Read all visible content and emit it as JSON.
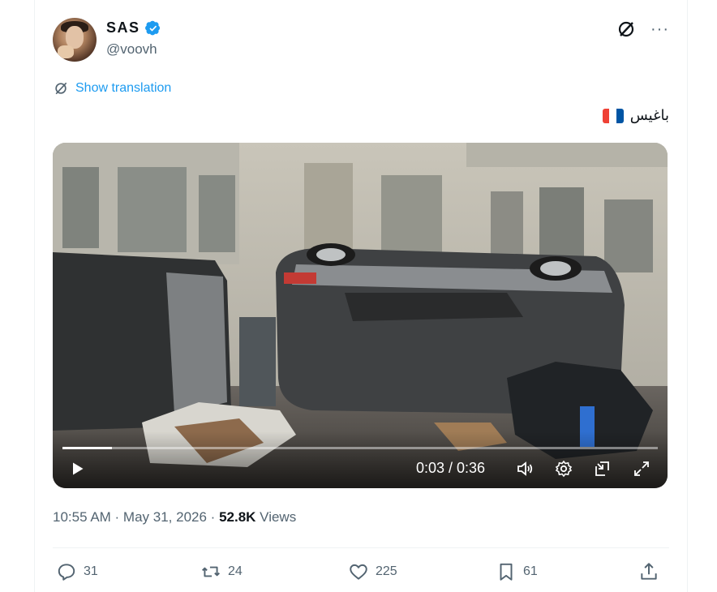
{
  "author": {
    "name": "SAS",
    "handle": "@voovh",
    "verified": true
  },
  "header": {
    "grok_icon": "grok-icon",
    "more_label": "···"
  },
  "translate": {
    "label": "Show translation"
  },
  "tweet": {
    "text": "باغيس",
    "flag": "France flag"
  },
  "video": {
    "time": "0:03 / 0:36",
    "progress": 0.083,
    "icons": [
      "play-icon",
      "volume-icon",
      "settings-icon",
      "pip-icon",
      "fullscreen-icon"
    ]
  },
  "meta": {
    "time_date": "10:55 AM · May 31, 2026 · ",
    "views_count": "52.8K",
    "views_label": " Views"
  },
  "actions": {
    "replies": "31",
    "reposts": "24",
    "likes": "225",
    "bookmarks": "61"
  },
  "colors": {
    "accent": "#1d9bf0",
    "text": "#0f1419",
    "muted": "#536471"
  }
}
